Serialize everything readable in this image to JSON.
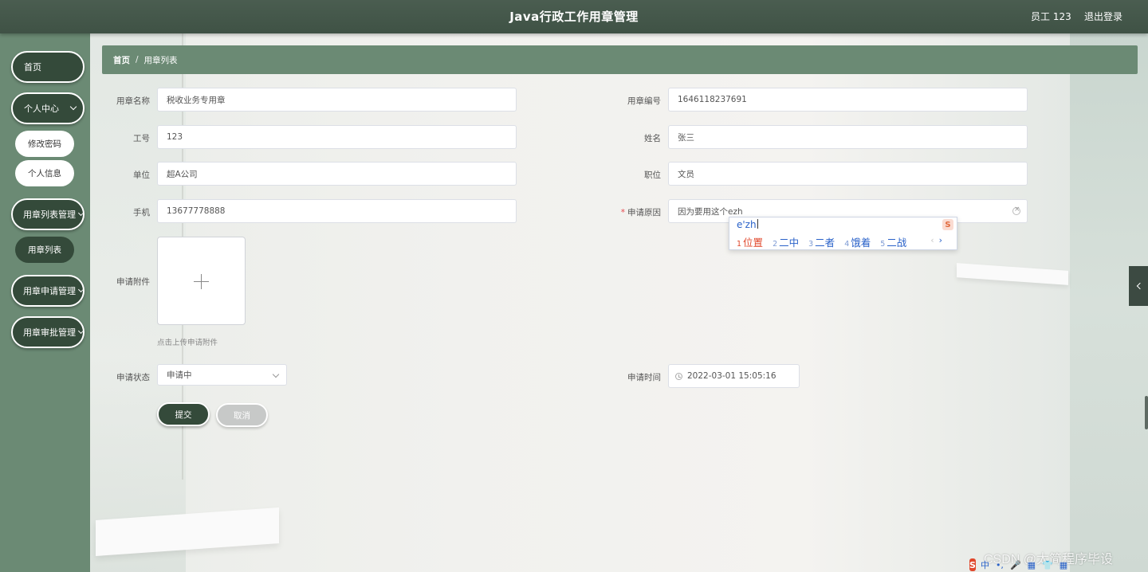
{
  "header": {
    "title": "Java行政工作用章管理",
    "user": "员工 123",
    "logout": "退出登录"
  },
  "sidebar": {
    "home": "首页",
    "personal": "个人中心",
    "change_password": "修改密码",
    "personal_info": "个人信息",
    "seal_list_mgmt": "用章列表管理",
    "seal_list": "用章列表",
    "seal_apply_mgmt": "用章申请管理",
    "seal_approve_mgmt": "用章审批管理"
  },
  "breadcrumb": {
    "home": "首页",
    "separator": "/",
    "current": "用章列表"
  },
  "form": {
    "seal_name_label": "用章名称",
    "seal_name_value": "税收业务专用章",
    "seal_no_label": "用章编号",
    "seal_no_value": "1646118237691",
    "emp_no_label": "工号",
    "emp_no_value": "123",
    "name_label": "姓名",
    "name_value": "张三",
    "unit_label": "单位",
    "unit_value": "超A公司",
    "position_label": "职位",
    "position_value": "文员",
    "phone_label": "手机",
    "phone_value": "13677778888",
    "reason_label": "申请原因",
    "reason_required": "*",
    "reason_value": "因为要用这个ezh",
    "attachment_label": "申请附件",
    "attachment_tip": "点击上传申请附件",
    "status_label": "申请状态",
    "status_value": "申请中",
    "time_label": "申请时间",
    "time_value": "2022-03-01 15:05:16",
    "submit": "提交",
    "cancel": "取消"
  },
  "ime": {
    "composition": "e'zh",
    "candidates": [
      {
        "num": "1",
        "text": "位置"
      },
      {
        "num": "2",
        "text": "二中"
      },
      {
        "num": "3",
        "text": "二者"
      },
      {
        "num": "4",
        "text": "饿着"
      },
      {
        "num": "5",
        "text": "二战"
      }
    ],
    "prev": "‹",
    "next": "›",
    "logo": "S"
  },
  "watermark": "CSDN @太简程序毕设",
  "imebar": {
    "logo": "S",
    "lang": "中",
    "punct": "•,",
    "mic": "🎤",
    "keyboard": "▦",
    "skin": "👕",
    "tools": "▦"
  }
}
